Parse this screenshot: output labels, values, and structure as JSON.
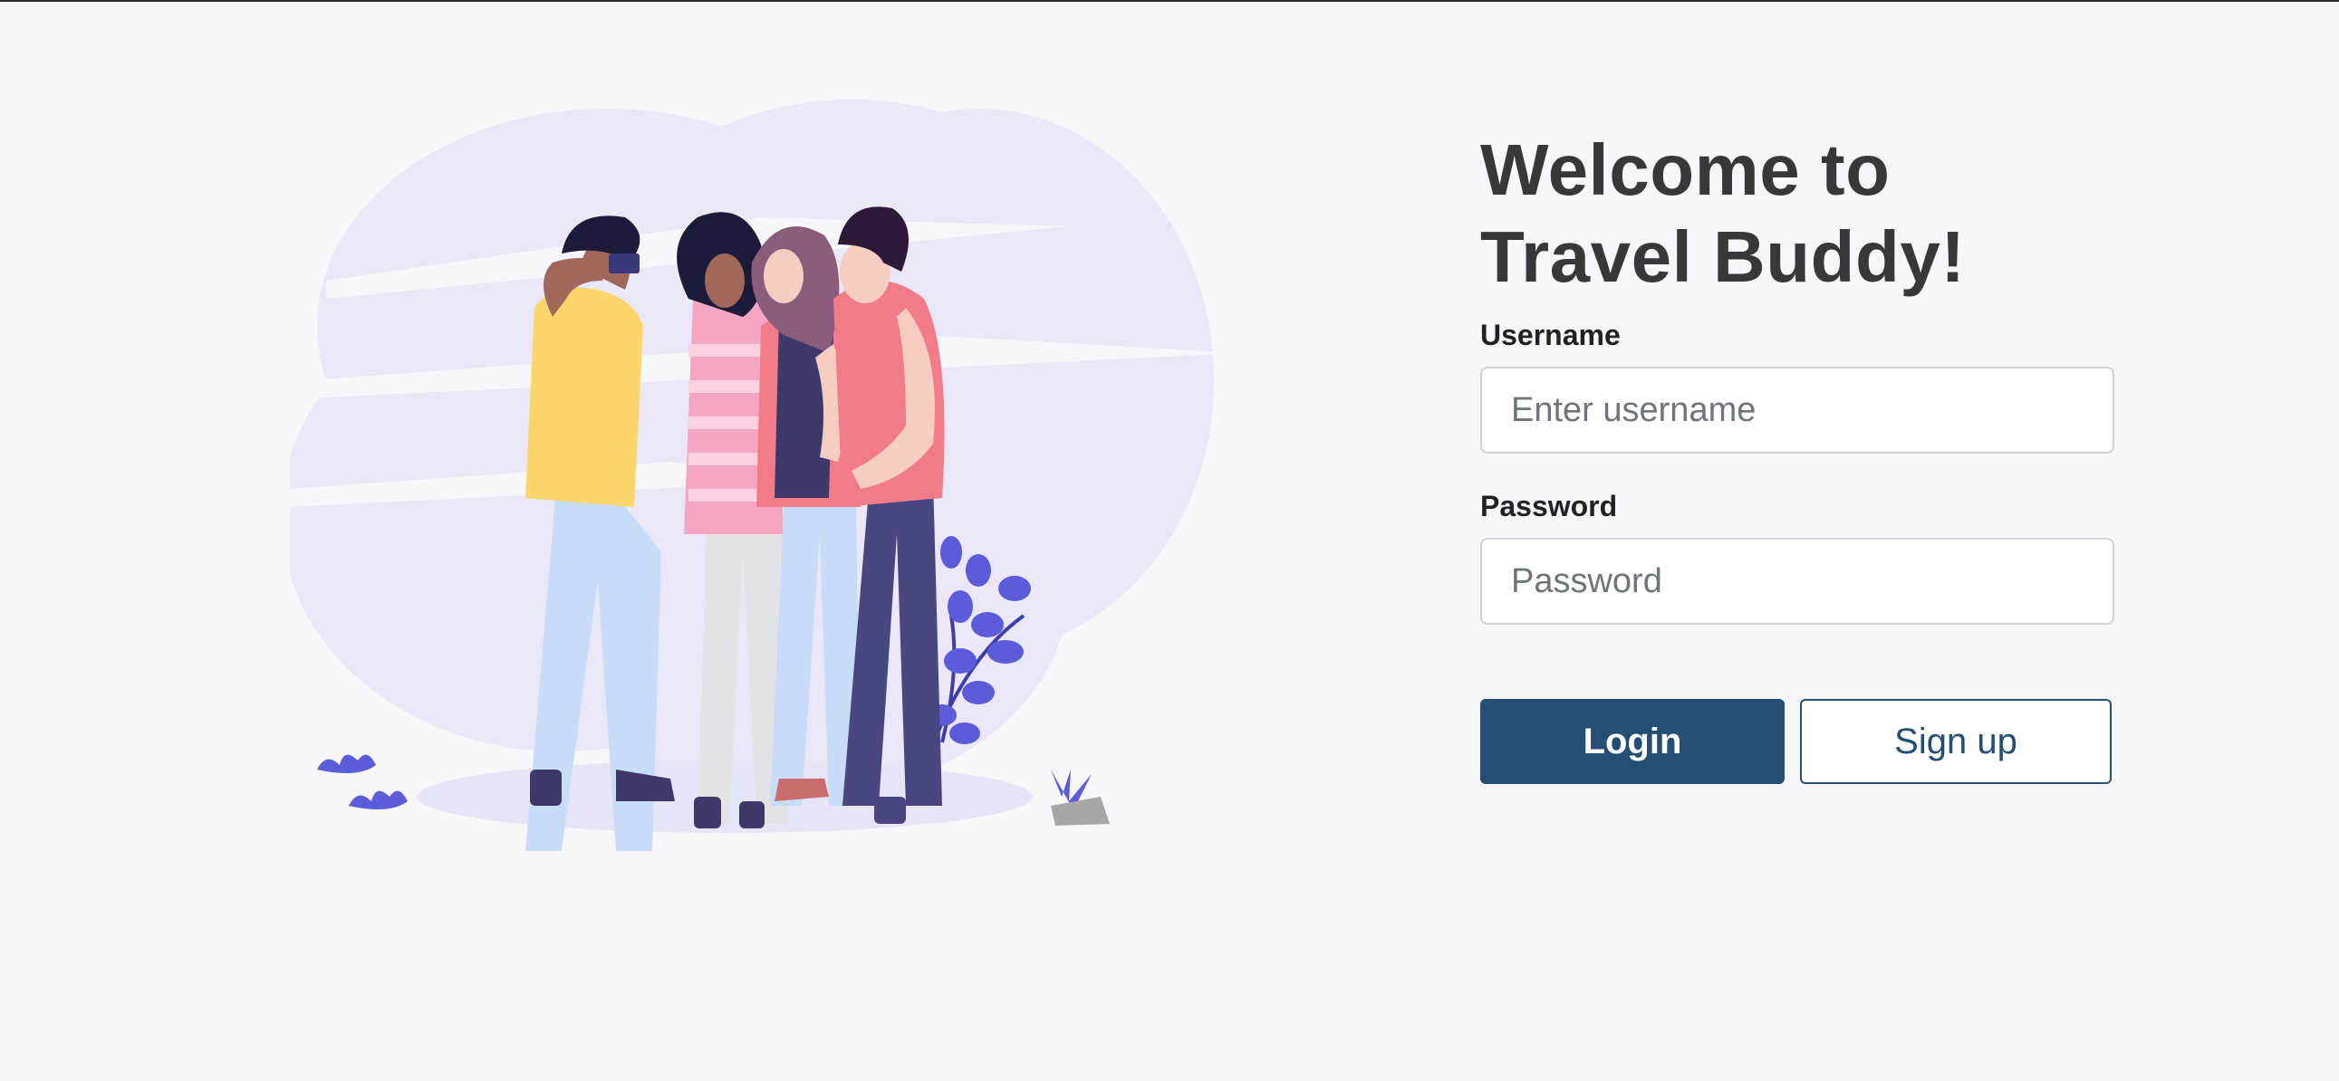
{
  "page": {
    "title": "Welcome to Travel Buddy!"
  },
  "form": {
    "username": {
      "label": "Username",
      "placeholder": "Enter username",
      "value": ""
    },
    "password": {
      "label": "Password",
      "placeholder": "Password",
      "value": ""
    }
  },
  "actions": {
    "login_label": "Login",
    "signup_label": "Sign up"
  },
  "illustration": {
    "icon": "friends-selfie-illustration"
  },
  "colors": {
    "background": "#f7f6fb",
    "heading": "#383838",
    "primary": "#254e74",
    "input_border": "#cfd2d7",
    "illustration_bg": "#e9e7f8",
    "plant": "#5c5bd9"
  }
}
